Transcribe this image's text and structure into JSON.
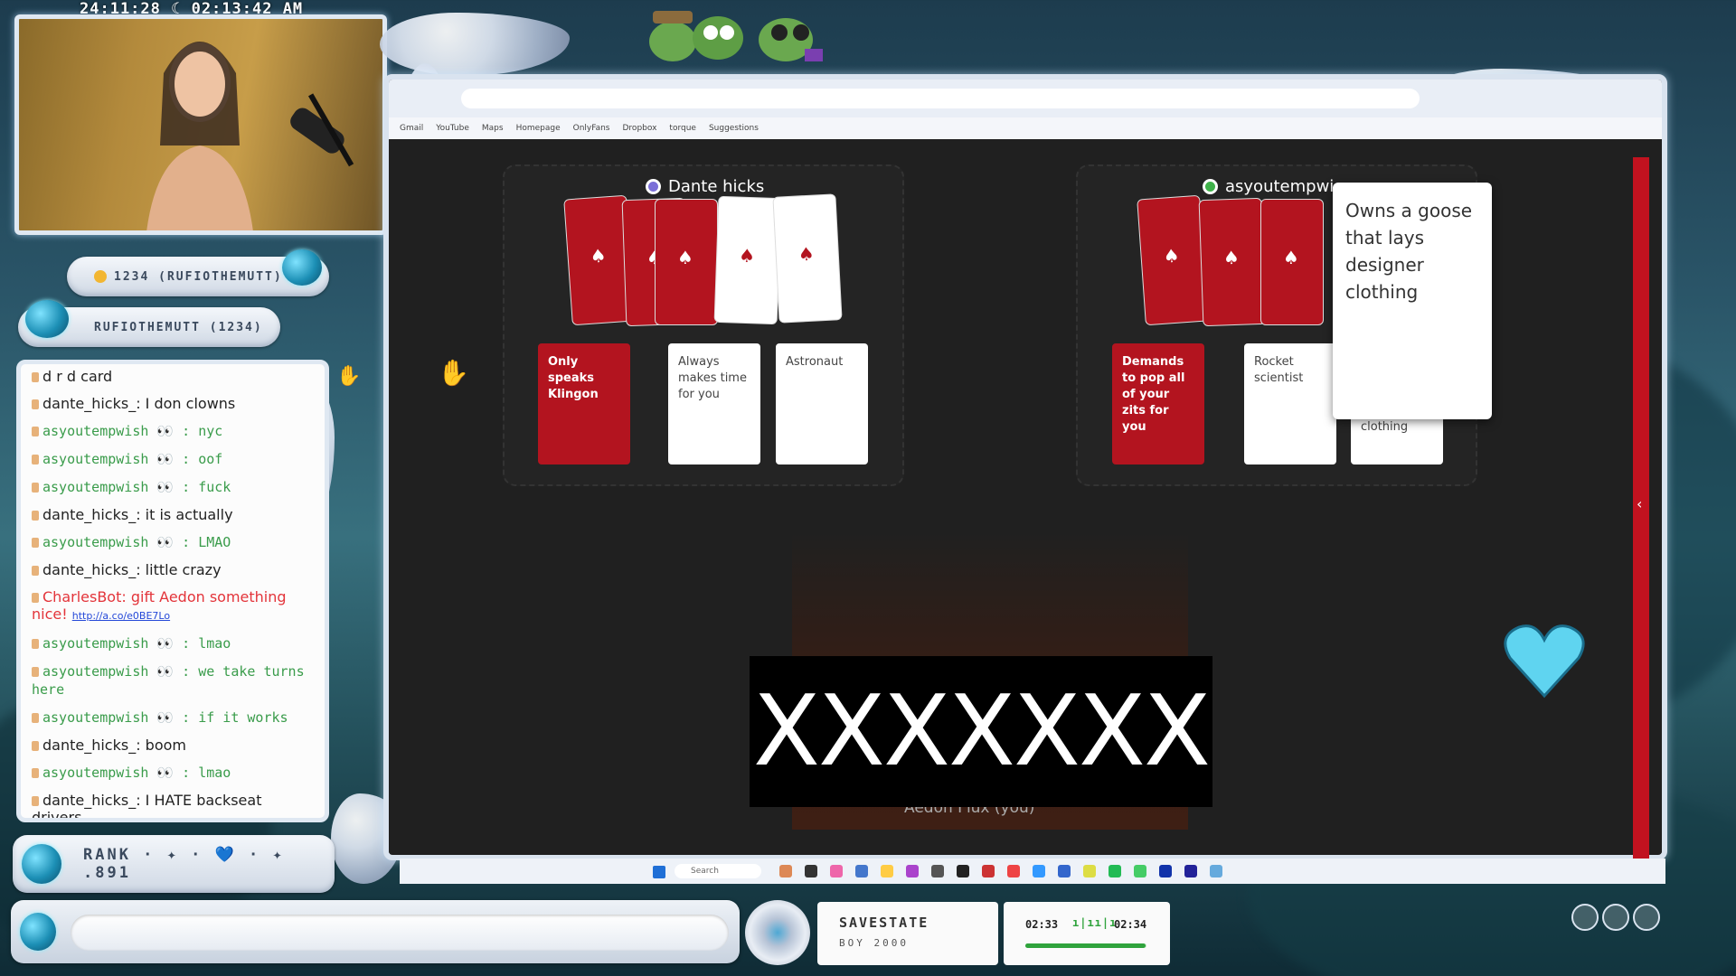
{
  "overlay": {
    "timestamp": "24:11:28 ☾ 02:13:42 AM",
    "sub_badge": "1234 (RUFIOTHEMUTT)",
    "follow_badge": "RUFIOTHEMUTT (1234)",
    "rank": "RANK · ✦ · 💙 · ✦ .891"
  },
  "chat": {
    "messages": [
      {
        "user": "d    r      d card",
        "text": "",
        "style": "plain"
      },
      {
        "user": "dante_hicks_",
        "text": ": I don    clowns",
        "style": "plain"
      },
      {
        "user": "asyoutempwish",
        "text": " 👀 : nyc",
        "style": "mono"
      },
      {
        "user": "asyoutempwish",
        "text": " 👀 : oof",
        "style": "mono"
      },
      {
        "user": "asyoutempwish",
        "text": " 👀 : fuck",
        "style": "mono"
      },
      {
        "user": "dante_hicks_",
        "text": ": it is actually",
        "style": "plain"
      },
      {
        "user": "asyoutempwish",
        "text": " 👀 : LMAO",
        "style": "mono"
      },
      {
        "user": "dante_hicks_",
        "text": ": little crazy",
        "style": "plain"
      },
      {
        "user": "CharlesBot",
        "text": ": gift Aedon something nice!",
        "link": "http://a.co/e0BE7Lo",
        "style": "bot"
      },
      {
        "user": "asyoutempwish",
        "text": " 👀 : lmao",
        "style": "mono"
      },
      {
        "user": "asyoutempwish",
        "text": " 👀 : we take turns here",
        "style": "mono"
      },
      {
        "user": "asyoutempwish",
        "text": " 👀 : if it works",
        "style": "mono"
      },
      {
        "user": "dante_hicks_",
        "text": ": boom",
        "style": "plain"
      },
      {
        "user": "asyoutempwish",
        "text": " 👀 : lmao",
        "style": "mono"
      },
      {
        "user": "dante_hicks_",
        "text": ": I HATE backseat drivers",
        "style": "plain"
      }
    ]
  },
  "browser": {
    "bookmarks": [
      "Gmail",
      "YouTube",
      "Maps",
      "Homepage",
      "OnlyFans",
      "Dropbox",
      "torque",
      "Suggestions"
    ]
  },
  "game": {
    "player1": {
      "name": "Dante hicks",
      "dot_color": "#7b6fd8",
      "cards": [
        {
          "text": "Only speaks Klingon",
          "color": "red"
        },
        {
          "text": "Always makes time for you",
          "color": "white"
        },
        {
          "text": "Astronaut",
          "color": "white"
        }
      ]
    },
    "player2": {
      "name": "asyoutempwi",
      "dot_color": "#3fb24a",
      "cards": [
        {
          "text": "Demands to pop all of your zits for you",
          "color": "red"
        },
        {
          "text": "Rocket scientist",
          "color": "white"
        },
        {
          "text": "clothing",
          "color": "white"
        }
      ]
    },
    "tooltip": "Owns a goose that lays designer clothing",
    "censor_text": "XXXXXXX",
    "self_label": "Aedon Flux (you)"
  },
  "taskbar": {
    "search_placeholder": "Search"
  },
  "now_playing": {
    "title": "SAVESTATE",
    "artist": "BOY 2000",
    "elapsed": "02:33",
    "total": "02:34",
    "progress": 0.99
  },
  "colors": {
    "accent_red": "#b3141f",
    "chat_green": "#3a9c4b",
    "bot_red": "#e3343a"
  }
}
